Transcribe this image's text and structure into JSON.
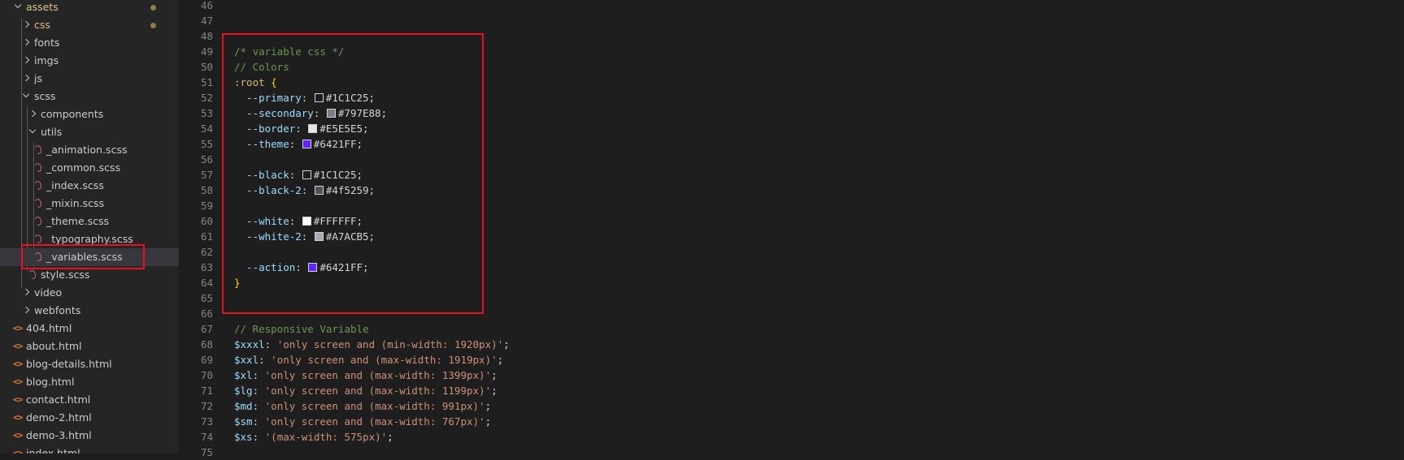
{
  "explorer": {
    "items": [
      {
        "label": "assets",
        "kind": "folder",
        "expanded": true,
        "depth": 0,
        "color": "#e2c08d",
        "modified": true
      },
      {
        "label": "css",
        "kind": "folder",
        "expanded": false,
        "depth": 1,
        "color": "#e2c08d",
        "modified": true
      },
      {
        "label": "fonts",
        "kind": "folder",
        "expanded": false,
        "depth": 1
      },
      {
        "label": "imgs",
        "kind": "folder",
        "expanded": false,
        "depth": 1
      },
      {
        "label": "js",
        "kind": "folder",
        "expanded": false,
        "depth": 1
      },
      {
        "label": "scss",
        "kind": "folder",
        "expanded": true,
        "depth": 1
      },
      {
        "label": "components",
        "kind": "folder",
        "expanded": false,
        "depth": 2
      },
      {
        "label": "utils",
        "kind": "folder",
        "expanded": true,
        "depth": 2
      },
      {
        "label": "_animation.scss",
        "kind": "scss",
        "depth": 3
      },
      {
        "label": "_common.scss",
        "kind": "scss",
        "depth": 3
      },
      {
        "label": "_index.scss",
        "kind": "scss",
        "depth": 3
      },
      {
        "label": "_mixin.scss",
        "kind": "scss",
        "depth": 3
      },
      {
        "label": "_theme.scss",
        "kind": "scss",
        "depth": 3
      },
      {
        "label": "_typography.scss",
        "kind": "scss",
        "depth": 3
      },
      {
        "label": "_variables.scss",
        "kind": "scss",
        "depth": 3,
        "selected": true
      },
      {
        "label": "style.scss",
        "kind": "scss",
        "depth": 2
      },
      {
        "label": "video",
        "kind": "folder",
        "expanded": false,
        "depth": 1
      },
      {
        "label": "webfonts",
        "kind": "folder",
        "expanded": false,
        "depth": 1
      },
      {
        "label": "404.html",
        "kind": "html",
        "depth": 0
      },
      {
        "label": "about.html",
        "kind": "html",
        "depth": 0
      },
      {
        "label": "blog-details.html",
        "kind": "html",
        "depth": 0
      },
      {
        "label": "blog.html",
        "kind": "html",
        "depth": 0
      },
      {
        "label": "contact.html",
        "kind": "html",
        "depth": 0
      },
      {
        "label": "demo-2.html",
        "kind": "html",
        "depth": 0
      },
      {
        "label": "demo-3.html",
        "kind": "html",
        "depth": 0
      },
      {
        "label": "index.html",
        "kind": "html",
        "depth": 0
      }
    ]
  },
  "editor": {
    "lines": [
      {
        "n": "46",
        "tokens": []
      },
      {
        "n": "47",
        "tokens": []
      },
      {
        "n": "48",
        "tokens": []
      },
      {
        "n": "49",
        "tokens": [
          {
            "t": "/* variable css */",
            "c": "cmt"
          }
        ]
      },
      {
        "n": "50",
        "tokens": [
          {
            "t": "// Colors",
            "c": "cmt"
          }
        ]
      },
      {
        "n": "51",
        "tokens": [
          {
            "t": ":root",
            "c": "sel"
          },
          {
            "t": " ",
            "c": "punc"
          },
          {
            "t": "{",
            "c": "brace"
          }
        ]
      },
      {
        "n": "52",
        "tokens": [
          {
            "t": "  --primary",
            "c": "prop"
          },
          {
            "t": ": ",
            "c": "punc"
          },
          {
            "swatch": "#1C1C25"
          },
          {
            "t": "#1C1C25;",
            "c": "punc"
          }
        ]
      },
      {
        "n": "53",
        "tokens": [
          {
            "t": "  --secondary",
            "c": "prop"
          },
          {
            "t": ": ",
            "c": "punc"
          },
          {
            "swatch": "#797E88"
          },
          {
            "t": "#797E88;",
            "c": "punc"
          }
        ]
      },
      {
        "n": "54",
        "tokens": [
          {
            "t": "  --border",
            "c": "prop"
          },
          {
            "t": ": ",
            "c": "punc"
          },
          {
            "swatch": "#E5E5E5"
          },
          {
            "t": "#E5E5E5;",
            "c": "punc"
          }
        ]
      },
      {
        "n": "55",
        "tokens": [
          {
            "t": "  --theme",
            "c": "prop"
          },
          {
            "t": ": ",
            "c": "punc"
          },
          {
            "swatch": "#6421FF"
          },
          {
            "t": "#6421FF;",
            "c": "punc"
          }
        ]
      },
      {
        "n": "56",
        "tokens": []
      },
      {
        "n": "57",
        "tokens": [
          {
            "t": "  --black",
            "c": "prop"
          },
          {
            "t": ": ",
            "c": "punc"
          },
          {
            "swatch": "#1C1C25"
          },
          {
            "t": "#1C1C25;",
            "c": "punc"
          }
        ]
      },
      {
        "n": "58",
        "tokens": [
          {
            "t": "  --black-2",
            "c": "prop"
          },
          {
            "t": ": ",
            "c": "punc"
          },
          {
            "swatch": "#4f5259"
          },
          {
            "t": "#4f5259;",
            "c": "punc"
          }
        ]
      },
      {
        "n": "59",
        "tokens": []
      },
      {
        "n": "60",
        "tokens": [
          {
            "t": "  --white",
            "c": "prop"
          },
          {
            "t": ": ",
            "c": "punc"
          },
          {
            "swatch": "#FFFFFF"
          },
          {
            "t": "#FFFFFF;",
            "c": "punc"
          }
        ]
      },
      {
        "n": "61",
        "tokens": [
          {
            "t": "  --white-2",
            "c": "prop"
          },
          {
            "t": ": ",
            "c": "punc"
          },
          {
            "swatch": "#A7ACB5"
          },
          {
            "t": "#A7ACB5;",
            "c": "punc"
          }
        ]
      },
      {
        "n": "62",
        "tokens": []
      },
      {
        "n": "63",
        "tokens": [
          {
            "t": "  --action",
            "c": "prop"
          },
          {
            "t": ": ",
            "c": "punc"
          },
          {
            "swatch": "#6421FF"
          },
          {
            "t": "#6421FF;",
            "c": "punc"
          }
        ]
      },
      {
        "n": "64",
        "tokens": [
          {
            "t": "}",
            "c": "brace"
          }
        ]
      },
      {
        "n": "65",
        "tokens": []
      },
      {
        "n": "66",
        "tokens": []
      },
      {
        "n": "67",
        "tokens": [
          {
            "t": "// Responsive Variable",
            "c": "cmt"
          }
        ]
      },
      {
        "n": "68",
        "tokens": [
          {
            "t": "$xxxl",
            "c": "prop"
          },
          {
            "t": ": ",
            "c": "punc"
          },
          {
            "t": "'only screen and (min-width: 1920px)'",
            "c": "str"
          },
          {
            "t": ";",
            "c": "punc"
          }
        ]
      },
      {
        "n": "69",
        "tokens": [
          {
            "t": "$xxl",
            "c": "prop"
          },
          {
            "t": ": ",
            "c": "punc"
          },
          {
            "t": "'only screen and (max-width: 1919px)'",
            "c": "str"
          },
          {
            "t": ";",
            "c": "punc"
          }
        ]
      },
      {
        "n": "70",
        "tokens": [
          {
            "t": "$xl",
            "c": "prop"
          },
          {
            "t": ": ",
            "c": "punc"
          },
          {
            "t": "'only screen and (max-width: 1399px)'",
            "c": "str"
          },
          {
            "t": ";",
            "c": "punc"
          }
        ]
      },
      {
        "n": "71",
        "tokens": [
          {
            "t": "$lg",
            "c": "prop"
          },
          {
            "t": ": ",
            "c": "punc"
          },
          {
            "t": "'only screen and (max-width: 1199px)'",
            "c": "str"
          },
          {
            "t": ";",
            "c": "punc"
          }
        ]
      },
      {
        "n": "72",
        "tokens": [
          {
            "t": "$md",
            "c": "prop"
          },
          {
            "t": ": ",
            "c": "punc"
          },
          {
            "t": "'only screen and (max-width: 991px)'",
            "c": "str"
          },
          {
            "t": ";",
            "c": "punc"
          }
        ]
      },
      {
        "n": "73",
        "tokens": [
          {
            "t": "$sm",
            "c": "prop"
          },
          {
            "t": ": ",
            "c": "punc"
          },
          {
            "t": "'only screen and (max-width: 767px)'",
            "c": "str"
          },
          {
            "t": ";",
            "c": "punc"
          }
        ]
      },
      {
        "n": "74",
        "tokens": [
          {
            "t": "$xs",
            "c": "prop"
          },
          {
            "t": ": ",
            "c": "punc"
          },
          {
            "t": "'(max-width: 575px)'",
            "c": "str"
          },
          {
            "t": ";",
            "c": "punc"
          }
        ]
      },
      {
        "n": "75",
        "tokens": []
      }
    ]
  },
  "colors": {
    "highlight_box": "#e81123",
    "modified_folder": "#e2c08d"
  }
}
